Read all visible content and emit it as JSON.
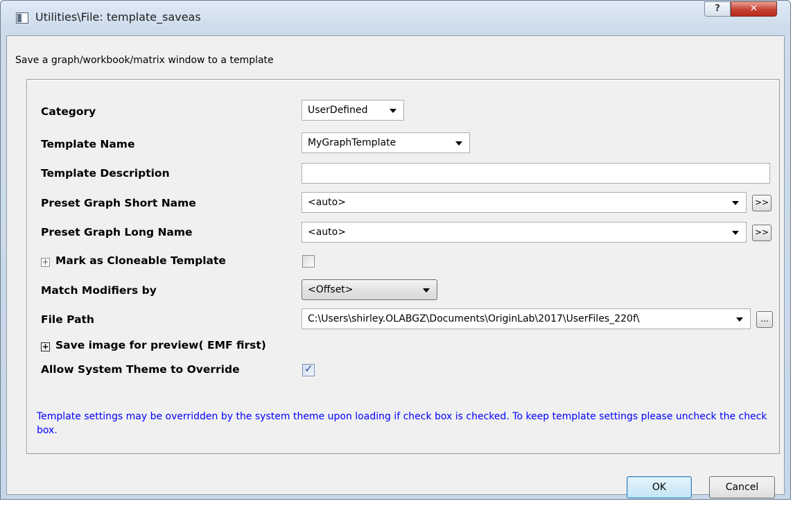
{
  "window": {
    "title": "Utilities\\File: template_saveas",
    "help_symbol": "?",
    "close_symbol": "✕"
  },
  "description": "Save a graph/workbook/matrix window to a template",
  "fields": {
    "category": {
      "label": "Category",
      "value": "UserDefined"
    },
    "template_name": {
      "label": "Template Name",
      "value": "MyGraphTemplate"
    },
    "template_description": {
      "label": "Template Description",
      "value": ""
    },
    "preset_short_name": {
      "label": "Preset Graph Short Name",
      "value": "<auto>",
      "button": ">>"
    },
    "preset_long_name": {
      "label": "Preset Graph Long Name",
      "value": "<auto>",
      "button": ">>"
    },
    "cloneable": {
      "label": "Mark as Cloneable Template",
      "expander": "+",
      "checked": false
    },
    "match_modifiers": {
      "label": "Match Modifiers by",
      "value": "<Offset>"
    },
    "file_path": {
      "label": "File Path",
      "value": "C:\\Users\\shirley.OLABGZ\\Documents\\OriginLab\\2017\\UserFiles_220f\\",
      "button": "..."
    },
    "save_image": {
      "label": "Save image for preview( EMF first)",
      "expander": "+"
    },
    "allow_theme": {
      "label": "Allow System Theme to Override",
      "checked": true,
      "check_mark": "✓"
    }
  },
  "note": "Template settings may be overridden by the system theme upon loading if check box is checked. To keep template settings please uncheck the check box.",
  "buttons": {
    "ok": "OK",
    "cancel": "Cancel"
  },
  "colors": {
    "note_text": "#0000ff",
    "close_button": "#c9473a"
  }
}
